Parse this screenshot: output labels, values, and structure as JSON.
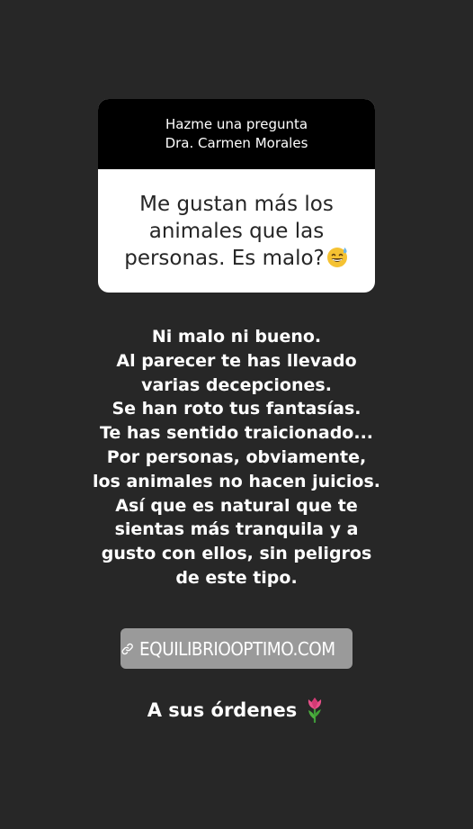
{
  "question_box": {
    "header_title": "Hazme una pregunta",
    "header_author": "Dra. Carmen Morales",
    "question_text": "Me gustan más los animales que las personas. Es malo?",
    "question_emoji": "grinning-sweat-emoji"
  },
  "answer": {
    "lines": [
      "Ni malo ni bueno.",
      "Al parecer te has llevado",
      "varias decepciones.",
      "Se han roto tus fantasías.",
      "Te has sentido traicionado...",
      "Por personas, obviamente,",
      "los animales no hacen juicios.",
      "Así que es natural que te",
      "sientas más tranquila y a",
      "gusto con ellos, sin peligros",
      "de este tipo."
    ]
  },
  "link_sticker": {
    "icon": "link-icon",
    "label": "EQUILIBRIOOPTIMO.COM"
  },
  "closing": {
    "text": "A sus órdenes",
    "icon": "tulip-icon"
  },
  "colors": {
    "background": "#272727",
    "question_header": "#000000",
    "question_body": "#ffffff",
    "link_sticker": "#9a9a9a",
    "text": "#ffffff"
  }
}
